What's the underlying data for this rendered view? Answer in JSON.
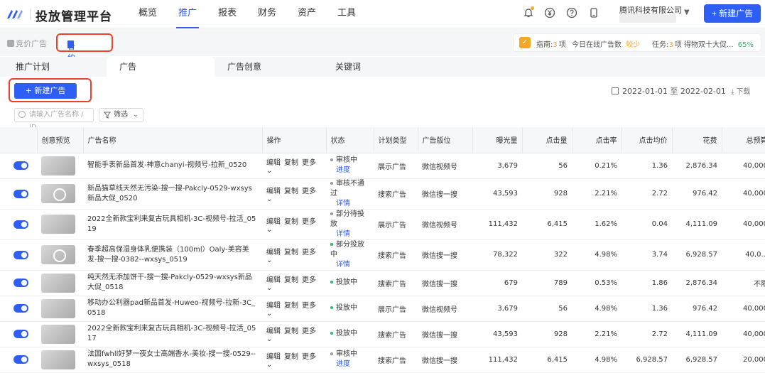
{
  "app": {
    "title": "投放管理平台",
    "company": "腾讯科技有限公司",
    "new_ad_top": "+ 新建广告"
  },
  "nav": [
    "概览",
    "推广",
    "报表",
    "财务",
    "资产",
    "工具"
  ],
  "subnav": {
    "bid": "竞价广告",
    "contract": "合约广告"
  },
  "info": {
    "guide_label": "指南:",
    "guide_count": "3",
    "guide_unit": "项",
    "online_label": "今日在线广告数",
    "online_value": "较少",
    "task_label": "任务:",
    "task_count": "3",
    "task_unit": "项",
    "task_text": "得物双十大促...",
    "task_pct": "65%"
  },
  "tabs": [
    "推广计划",
    "广告",
    "广告创意",
    "关键词"
  ],
  "toolbar": {
    "new_ad": "+ 新建广告",
    "date_range": "2022-01-01 至 2022-02-01",
    "download": "下载"
  },
  "search": {
    "placeholder": "请输入广告名称 / ID",
    "filter": "筛选"
  },
  "columns": [
    "",
    "创意预览",
    "广告名称",
    "操作",
    "状态",
    "计划类型",
    "广告版位",
    "曝光量",
    "点击量",
    "点击率",
    "点击均价",
    "花费",
    "总预算"
  ],
  "ops": {
    "edit": "编辑",
    "copy": "复制",
    "more": "更多"
  },
  "colors": {
    "accent": "#2f5ef5",
    "gray": "#999999",
    "green": "#2bb673",
    "highlight": "#e8432a"
  },
  "rows": [
    {
      "name": "智能手表新品首发-神意chanyi-视频号-拉新_0520",
      "thumb": "plain",
      "status": "审核中",
      "status_color": "#999999",
      "link": "进度",
      "plan": "展示广告",
      "slot": "微信视频号",
      "imp": "3,679",
      "clk": "56",
      "ctr": "0.21%",
      "cpc": "1.36",
      "cost": "2,876.34",
      "budget": "40,000"
    },
    {
      "name": "新品猫草线天然无污染-搜一搜-Pakcly-0529-wxsys新品大促_0520",
      "thumb": "play",
      "status": "审核不通过",
      "status_color": "#999999",
      "link": "详情",
      "plan": "搜索广告",
      "slot": "微信搜一搜",
      "imp": "43,593",
      "clk": "928",
      "ctr": "2.21%",
      "cpc": "2.72",
      "cost": "976.42",
      "budget": "40,000"
    },
    {
      "name": "2022全新款宝利来复古玩具相机-3C-视频号-拉活_0519",
      "thumb": "plain",
      "status": "部分待投放",
      "status_color": "#999999",
      "link": "详情",
      "plan": "展示广告",
      "slot": "微信视频号",
      "imp": "111,432",
      "clk": "6,415",
      "ctr": "1.62%",
      "cpc": "0.04",
      "cost": "4,111.09",
      "budget": "40,000"
    },
    {
      "name": "春季超高保湿身体乳便携装（100ml）Oaly-美容美发-搜一搜-0382--wxsys_0519",
      "thumb": "play",
      "status": "部分投放中",
      "status_color": "#2bb673",
      "link": "详情",
      "plan": "搜索广告",
      "slot": "微信搜一搜",
      "imp": "78,322",
      "clk": "322",
      "ctr": "4.98%",
      "cpc": "3.74",
      "cost": "6,928.57",
      "budget": "40,0..."
    },
    {
      "name": "纯天然无添加饼干-搜一搜-Pakcly-0529-wxsys新品大促_0518",
      "thumb": "plain",
      "status": "投放中",
      "status_color": "#2bb673",
      "link": "",
      "plan": "搜索广告",
      "slot": "微信搜一搜",
      "imp": "679",
      "clk": "789",
      "ctr": "0.53%",
      "cpc": "1.86",
      "cost": "2,876.34",
      "budget": "不限"
    },
    {
      "name": "移动办公利器pad新品首发-Huweo-视频号-拉新-3C_0518",
      "thumb": "plain",
      "status": "投放中",
      "status_color": "#2bb673",
      "link": "",
      "plan": "展示广告",
      "slot": "微信视频号",
      "imp": "3,679",
      "clk": "56",
      "ctr": "4.98%",
      "cpc": "1.36",
      "cost": "976.42",
      "budget": "40,000"
    },
    {
      "name": "2022全新款宝利来复古玩具相机-3C-视频号-拉活_0517",
      "thumb": "plain",
      "status": "投放中",
      "status_color": "#2bb673",
      "link": "",
      "plan": "搜索广告",
      "slot": "微信搜一搜",
      "imp": "43,593",
      "clk": "928",
      "ctr": "2.21%",
      "cpc": "2.72",
      "cost": "4,111.09",
      "budget": "40,000"
    },
    {
      "name": "法国fwhll好梦一夜女士高端香水-美妆-搜一搜-0529--wxsys_0518",
      "thumb": "plain",
      "status": "审核中",
      "status_color": "#999999",
      "link": "进度",
      "plan": "搜索广告",
      "slot": "微信搜一搜",
      "imp": "111,432",
      "clk": "6,415",
      "ctr": "4.98%",
      "cpc": "6,928.57",
      "cost": "6,928.57",
      "budget": "20,000"
    }
  ]
}
